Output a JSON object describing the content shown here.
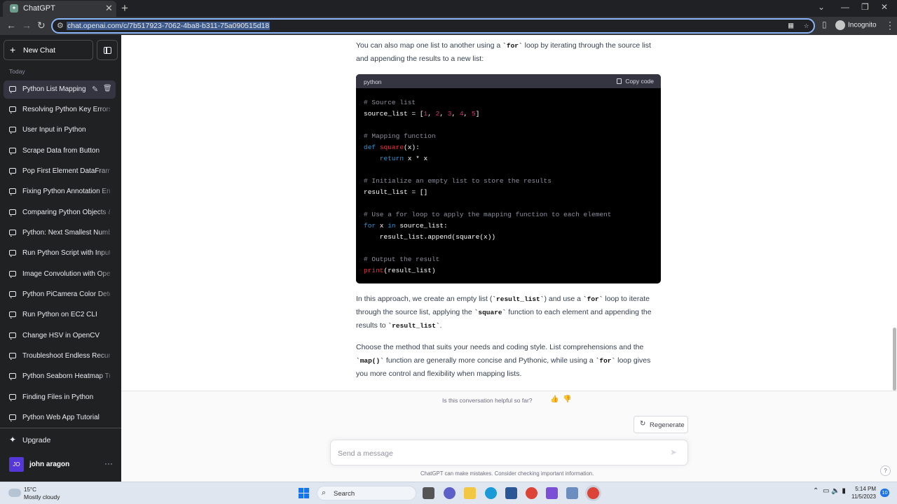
{
  "browser": {
    "tab_title": "ChatGPT",
    "url": "chat.openai.com/c/7b517923-7062-4ba8-b311-75a090515d18",
    "profile_label": "Incognito"
  },
  "sidebar": {
    "new_chat_label": "New Chat",
    "section_label": "Today",
    "chats": [
      "Python List Mapping",
      "Resolving Python Key Errors",
      "User Input in Python",
      "Scrape Data from Button",
      "Pop First Element DataFrame",
      "Fixing Python Annotation Errors",
      "Comparing Python Objects &",
      "Python: Next Smallest Number",
      "Run Python Script with Input",
      "Image Convolution with OpenCV",
      "Python PiCamera Color Detection",
      "Run Python on EC2 CLI",
      "Change HSV in OpenCV",
      "Troubleshoot Endless Recursion",
      "Python Seaborn Heatmap Tutorial",
      "Finding Files in Python",
      "Python Web App Tutorial"
    ],
    "upgrade_label": "Upgrade",
    "user_initials": "JO",
    "user_name": "john aragon"
  },
  "conversation": {
    "intro_part1": "You can also map one list to another using a ",
    "intro_code": "`for`",
    "intro_part2": " loop by iterating through the source list and appending the results to a new list:",
    "code_lang": "python",
    "copy_label": "Copy code",
    "code": {
      "l1": "# Source list",
      "l2a": "source_list = [",
      "n1": "1",
      "n2": "2",
      "n3": "3",
      "n4": "4",
      "n5": "5",
      "sep": ", ",
      "close": "]",
      "l4": "# Mapping function",
      "def": "def",
      "sq": "square",
      "l5rest": "(x):",
      "ret": "return",
      "l6rest": " x * x",
      "l8": "# Initialize an empty list to store the results",
      "l9": "result_list = []",
      "l11": "# Use a for loop to apply the mapping function to each element",
      "for": "for",
      "l12a": " x ",
      "in": "in",
      "l12b": " source_list:",
      "l13": "    result_list.append(square(x))",
      "l15": "# Output the result",
      "print": "print",
      "l16rest": "(result_list)"
    },
    "p2_a": "In this approach, we create an empty list (",
    "p2_c1": "`result_list`",
    "p2_b": ") and use a ",
    "p2_c2": "`for`",
    "p2_c": " loop to iterate through the source list, applying the ",
    "p2_c3": "`square`",
    "p2_d": " function to each element and appending the results to ",
    "p2_c4": "`result_list`",
    "p2_e": ".",
    "p3_a": "Choose the method that suits your needs and coding style. List comprehensions and the ",
    "p3_c1": "`map()`",
    "p3_b": " function are generally more concise and Pythonic, while using a ",
    "p3_c2": "`for`",
    "p3_c": " loop gives you more control and flexibility when mapping lists."
  },
  "footer": {
    "helpful_prompt": "Is this conversation helpful so far?",
    "regenerate_label": "Regenerate",
    "message_placeholder": "Send a message",
    "disclaimer": "ChatGPT can make mistakes. Consider checking important information.",
    "help_label": "?"
  },
  "taskbar": {
    "temperature": "15°C",
    "weather": "Mostly cloudy",
    "search_label": "Search",
    "time": "5:14 PM",
    "date": "11/5/2023",
    "notification_count": "10"
  },
  "colors": {
    "sidebar_bg": "#202123",
    "code_bg": "#000000",
    "accent_url_focus": "#8ab4f8"
  }
}
